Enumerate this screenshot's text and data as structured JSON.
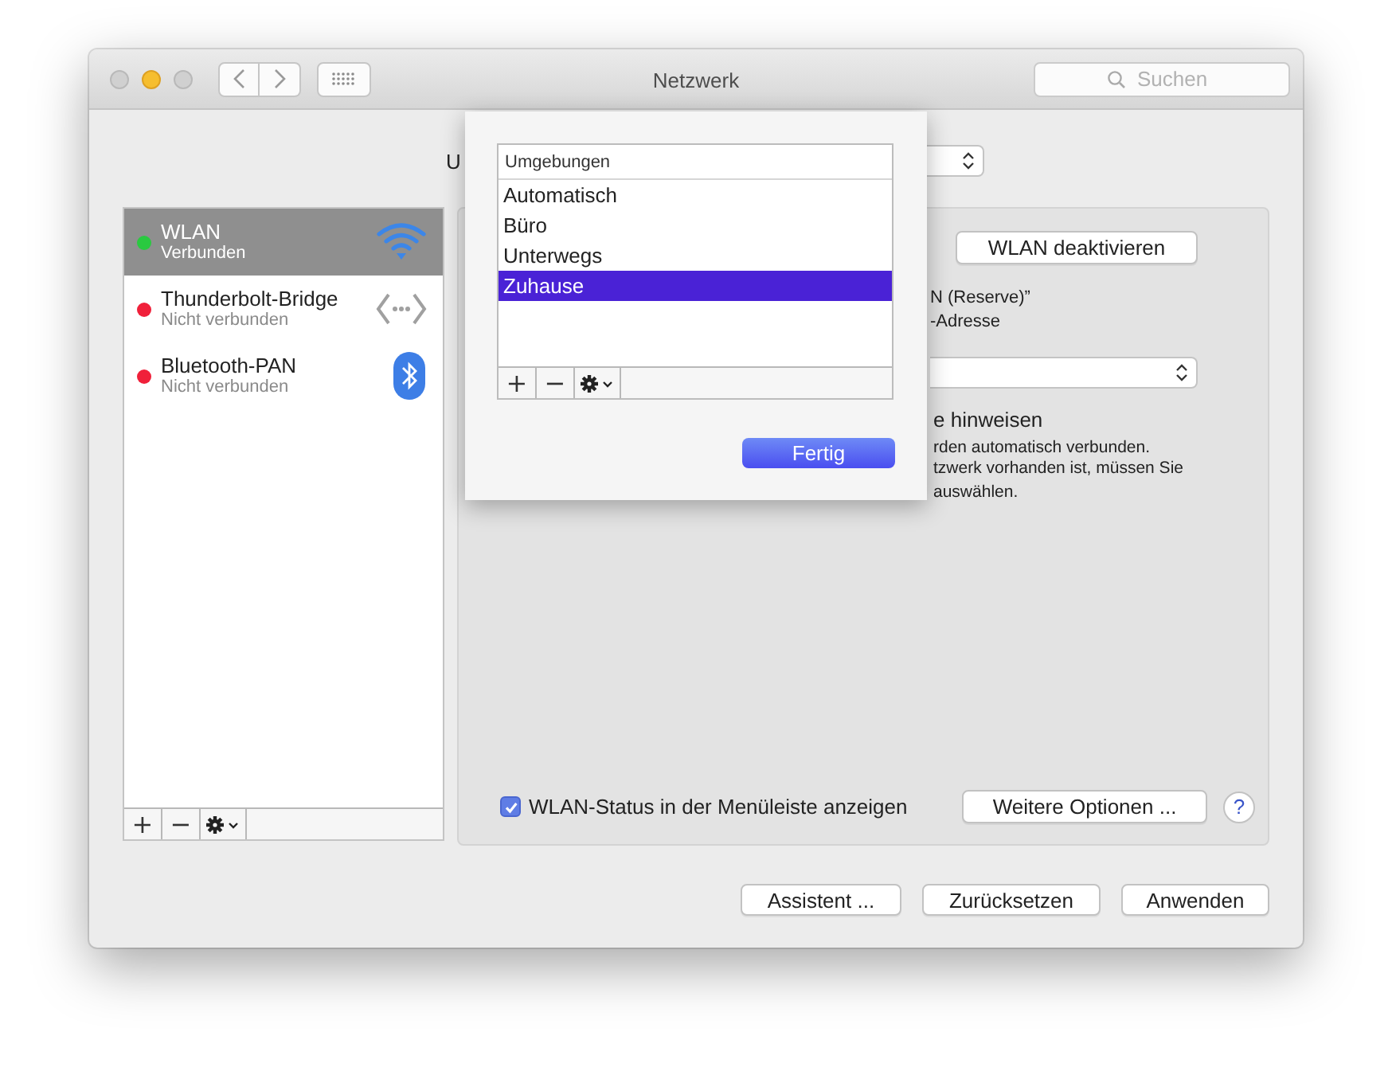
{
  "window": {
    "title": "Netzwerk",
    "search": {
      "placeholder": "Suchen"
    }
  },
  "location": {
    "label": "U"
  },
  "services": [
    {
      "name": "WLAN",
      "status": "Verbunden",
      "color": "#2ac940",
      "selected": true,
      "kind": "wifi"
    },
    {
      "name": "Thunderbolt-Bridge",
      "status": "Nicht verbunden",
      "color": "#f0203a",
      "selected": false,
      "kind": "bridge"
    },
    {
      "name": "Bluetooth-PAN",
      "status": "Nicht verbunden",
      "color": "#f0203a",
      "selected": false,
      "kind": "bluetooth"
    }
  ],
  "list_controls": [
    "+",
    "−"
  ],
  "detail": {
    "toggle_button": "WLAN deaktivieren",
    "lines": [
      "N (Reserve)”",
      "-Adresse"
    ],
    "heading": "e hinweisen",
    "notes": [
      "rden automatisch verbunden.",
      "tzwerk vorhanden ist, müssen Sie",
      "auswählen."
    ],
    "menubar_checkbox": {
      "label": "WLAN-Status in der Menüleiste anzeigen",
      "checked": true
    },
    "options_button": "Weitere Optionen ...",
    "help": "?"
  },
  "buttons": [
    "Assistent ...",
    "Zurücksetzen",
    "Anwenden"
  ],
  "sheet": {
    "header": "Umgebungen",
    "items": [
      {
        "label": "Automatisch",
        "selected": false
      },
      {
        "label": "Büro",
        "selected": false
      },
      {
        "label": "Unterwegs",
        "selected": false
      },
      {
        "label": "Zuhause",
        "selected": true
      }
    ],
    "controls": [
      "+",
      "−"
    ],
    "done_button": "Fertig"
  }
}
